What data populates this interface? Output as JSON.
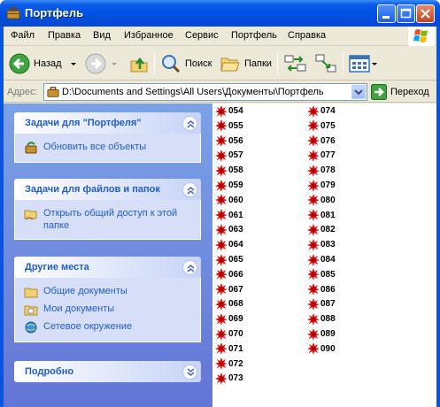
{
  "window": {
    "title": "Портфель"
  },
  "menu": [
    "Файл",
    "Правка",
    "Вид",
    "Избранное",
    "Сервис",
    "Портфель",
    "Справка"
  ],
  "toolbar": {
    "back_label": "Назад",
    "search_label": "Поиск",
    "folders_label": "Папки"
  },
  "address": {
    "label": "Адрес:",
    "path": "D:\\Documents and Settings\\All Users\\Документы\\Портфель",
    "go_label": "Переход"
  },
  "left_panel": {
    "groups": [
      {
        "title": "Задачи для \"Портфеля\"",
        "tasks": [
          {
            "label": "Обновить все объекты",
            "icon": "update-icon"
          }
        ]
      },
      {
        "title": "Задачи для файлов и папок",
        "tasks": [
          {
            "label": "Открыть общий доступ к этой папке",
            "icon": "share-folder-icon"
          }
        ]
      },
      {
        "title": "Другие места",
        "tasks": [
          {
            "label": "Общие документы",
            "icon": "folder-icon"
          },
          {
            "label": "Мои документы",
            "icon": "my-documents-icon"
          },
          {
            "label": "Сетевое окружение",
            "icon": "network-icon"
          }
        ]
      },
      {
        "title": "Подробно",
        "tasks": []
      }
    ]
  },
  "files": {
    "column1": [
      "054",
      "055",
      "056",
      "057",
      "058",
      "059",
      "060",
      "061",
      "063",
      "064",
      "065",
      "066",
      "067",
      "068",
      "069",
      "070",
      "071",
      "072",
      "073"
    ],
    "column2": [
      "074",
      "075",
      "076",
      "077",
      "078",
      "079",
      "080",
      "081",
      "082",
      "083",
      "084",
      "085",
      "086",
      "087",
      "088",
      "089",
      "090"
    ]
  },
  "colors": {
    "titlebar": "#0a55e0",
    "task_link": "#215dc6",
    "file_icon": "#e01010"
  }
}
